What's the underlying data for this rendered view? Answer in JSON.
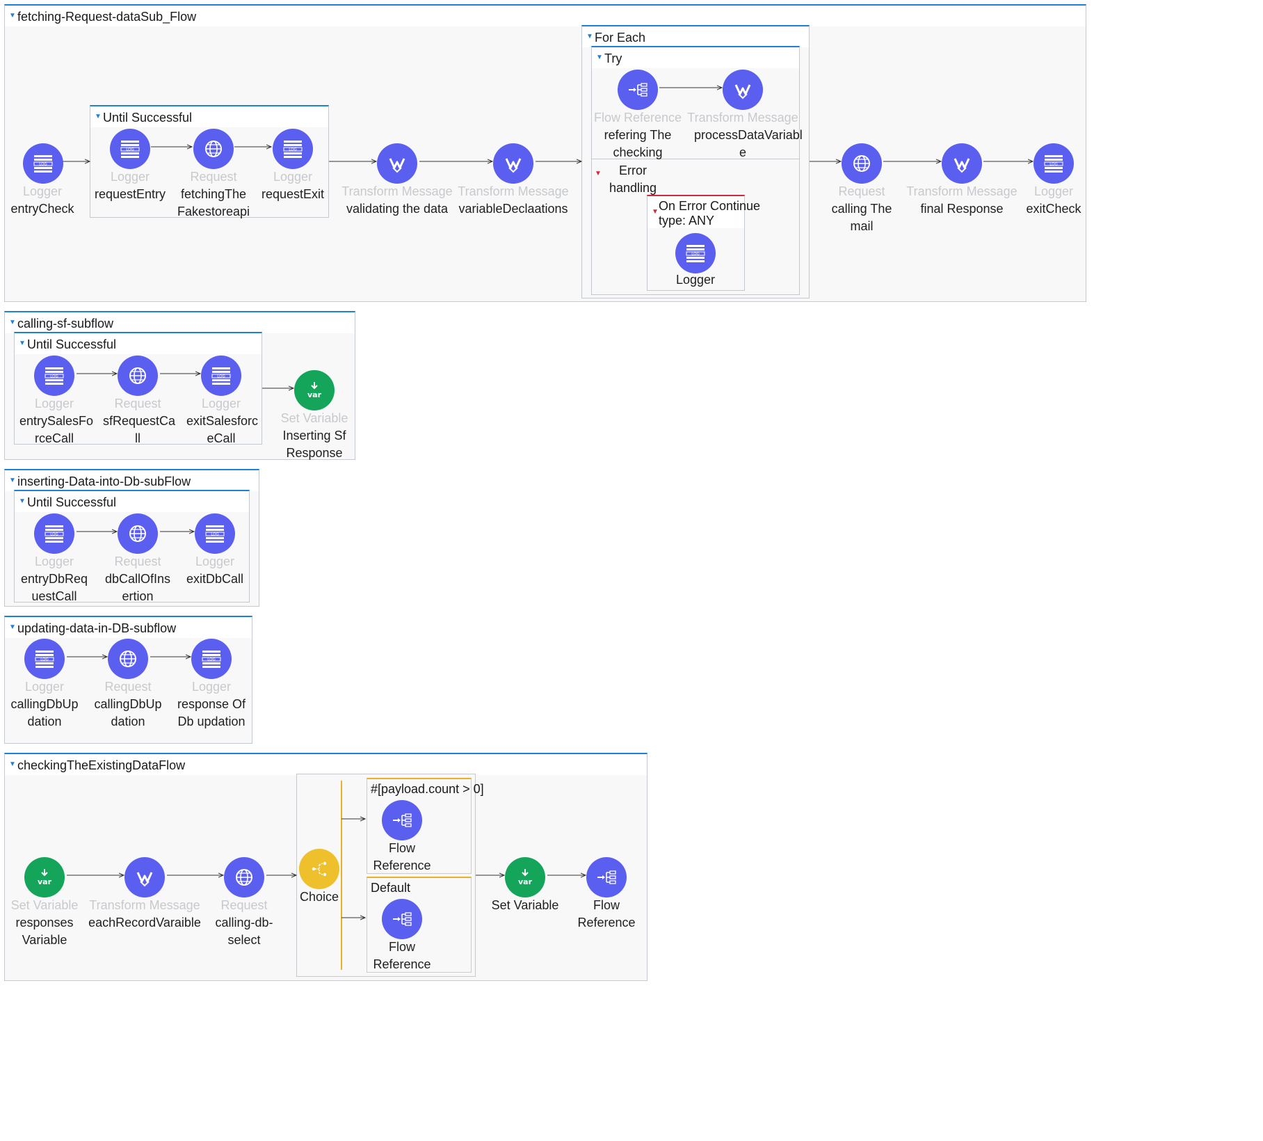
{
  "flows": [
    {
      "title": "fetching-Request-dataSub_Flow",
      "nodes": [
        {
          "type": "Logger",
          "name": "entryCheck"
        },
        {
          "type": "Transform Message",
          "name": "validating the data"
        },
        {
          "type": "Transform Message",
          "name": "variableDeclaations"
        },
        {
          "type": "Request",
          "name": "calling The mail"
        },
        {
          "type": "Transform Message",
          "name": "final Response"
        },
        {
          "type": "Logger",
          "name": "exitCheck"
        }
      ],
      "until_successful": {
        "title": "Until Successful",
        "nodes": [
          {
            "type": "Logger",
            "name": "requestEntry"
          },
          {
            "type": "Request",
            "name": "fetchingThe Fakestoreapi"
          },
          {
            "type": "Logger",
            "name": "requestExit"
          }
        ]
      },
      "for_each": {
        "title": "For Each",
        "try_title": "Try",
        "try_nodes": [
          {
            "type": "Flow Reference",
            "name": "refering The checking"
          },
          {
            "type": "Transform Message",
            "name": "processDataVariabl e"
          }
        ],
        "error_handling": "Error handling",
        "on_error": {
          "title": "On Error Continue",
          "subtitle": "type: ANY",
          "node_name": "Logger"
        }
      }
    },
    {
      "title": "calling-sf-subflow",
      "until_successful": {
        "title": "Until Successful",
        "nodes": [
          {
            "type": "Logger",
            "name": "entrySalesFo rceCall"
          },
          {
            "type": "Request",
            "name": "sfRequestCa ll"
          },
          {
            "type": "Logger",
            "name": "exitSalesforc eCall"
          }
        ]
      },
      "nodes": [
        {
          "type": "Set Variable",
          "name": "Inserting Sf Response"
        }
      ]
    },
    {
      "title": "inserting-Data-into-Db-subFlow",
      "until_successful": {
        "title": "Until Successful",
        "nodes": [
          {
            "type": "Logger",
            "name": "entryDbReq uestCall"
          },
          {
            "type": "Request",
            "name": "dbCallOfIns ertion"
          },
          {
            "type": "Logger",
            "name": "exitDbCall"
          }
        ]
      }
    },
    {
      "title": "updating-data-in-DB-subflow",
      "nodes": [
        {
          "type": "Logger",
          "name": "callingDbUp dation"
        },
        {
          "type": "Request",
          "name": "callingDbUp dation"
        },
        {
          "type": "Logger",
          "name": "response Of Db updation"
        }
      ]
    },
    {
      "title": "checkingTheExistingDataFlow",
      "nodes": [
        {
          "type": "Set Variable",
          "name": "responses Variable"
        },
        {
          "type": "Transform Message",
          "name": "eachRecordVaraible"
        },
        {
          "type": "Request",
          "name": "calling-db- select"
        },
        {
          "type": "",
          "name": "Set Variable"
        },
        {
          "type": "",
          "name": "Flow Reference"
        }
      ],
      "choice": {
        "name": "Choice",
        "when": {
          "condition": "#[payload.count > 0]",
          "node_name": "Flow Reference"
        },
        "default": {
          "label": "Default",
          "node_name": "Flow Reference"
        }
      }
    }
  ],
  "icons": {
    "logger": "log-icon",
    "request": "globe-icon",
    "transform": "transform-icon",
    "set_variable": "var-icon",
    "flow_reference": "flow-ref-icon",
    "choice": "choice-icon"
  },
  "colors": {
    "scope_header": "#1f80d8",
    "error_header": "#d0283c",
    "route_header": "#e9b02a",
    "node_blue": "#5a5ff0",
    "node_green": "#15a55a",
    "node_yellow": "#eec12c"
  }
}
